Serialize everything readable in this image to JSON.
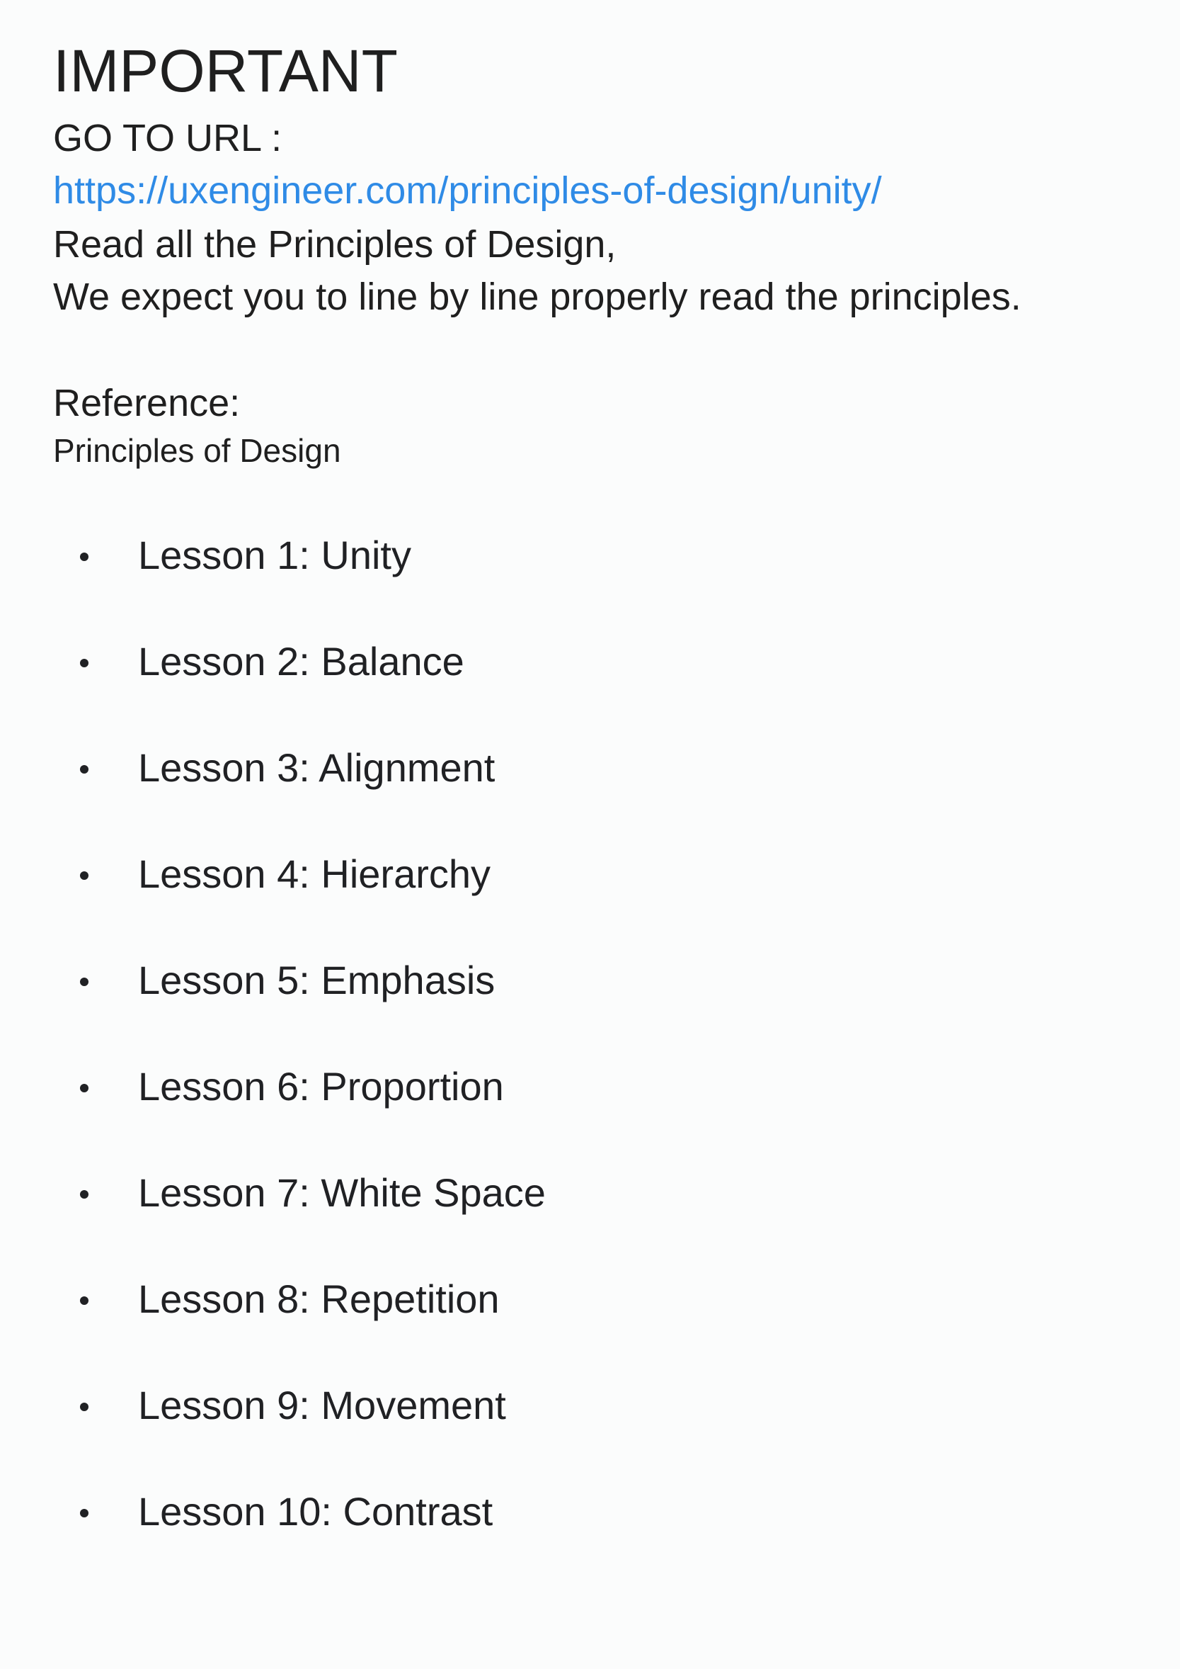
{
  "document": {
    "title": "IMPORTANT",
    "goto_label": "GO TO URL :",
    "url": "https://uxengineer.com/principles-of-design/unity/",
    "instruction_line_1": "Read all the Principles of Design,",
    "instruction_line_2": "We expect you to line by line properly read the principles.",
    "reference_label": "Reference:",
    "reference_title": "Principles of Design",
    "lessons": [
      "Lesson 1: Unity",
      "Lesson 2: Balance",
      "Lesson 3: Alignment",
      "Lesson 4: Hierarchy",
      "Lesson 5: Emphasis",
      "Lesson 6: Proportion",
      "Lesson 7: White Space",
      "Lesson 8: Repetition",
      "Lesson 9: Movement",
      "Lesson 10: Contrast"
    ]
  },
  "colors": {
    "background": "#fbfcfc",
    "text": "#202124",
    "link": "#2f8be6"
  }
}
